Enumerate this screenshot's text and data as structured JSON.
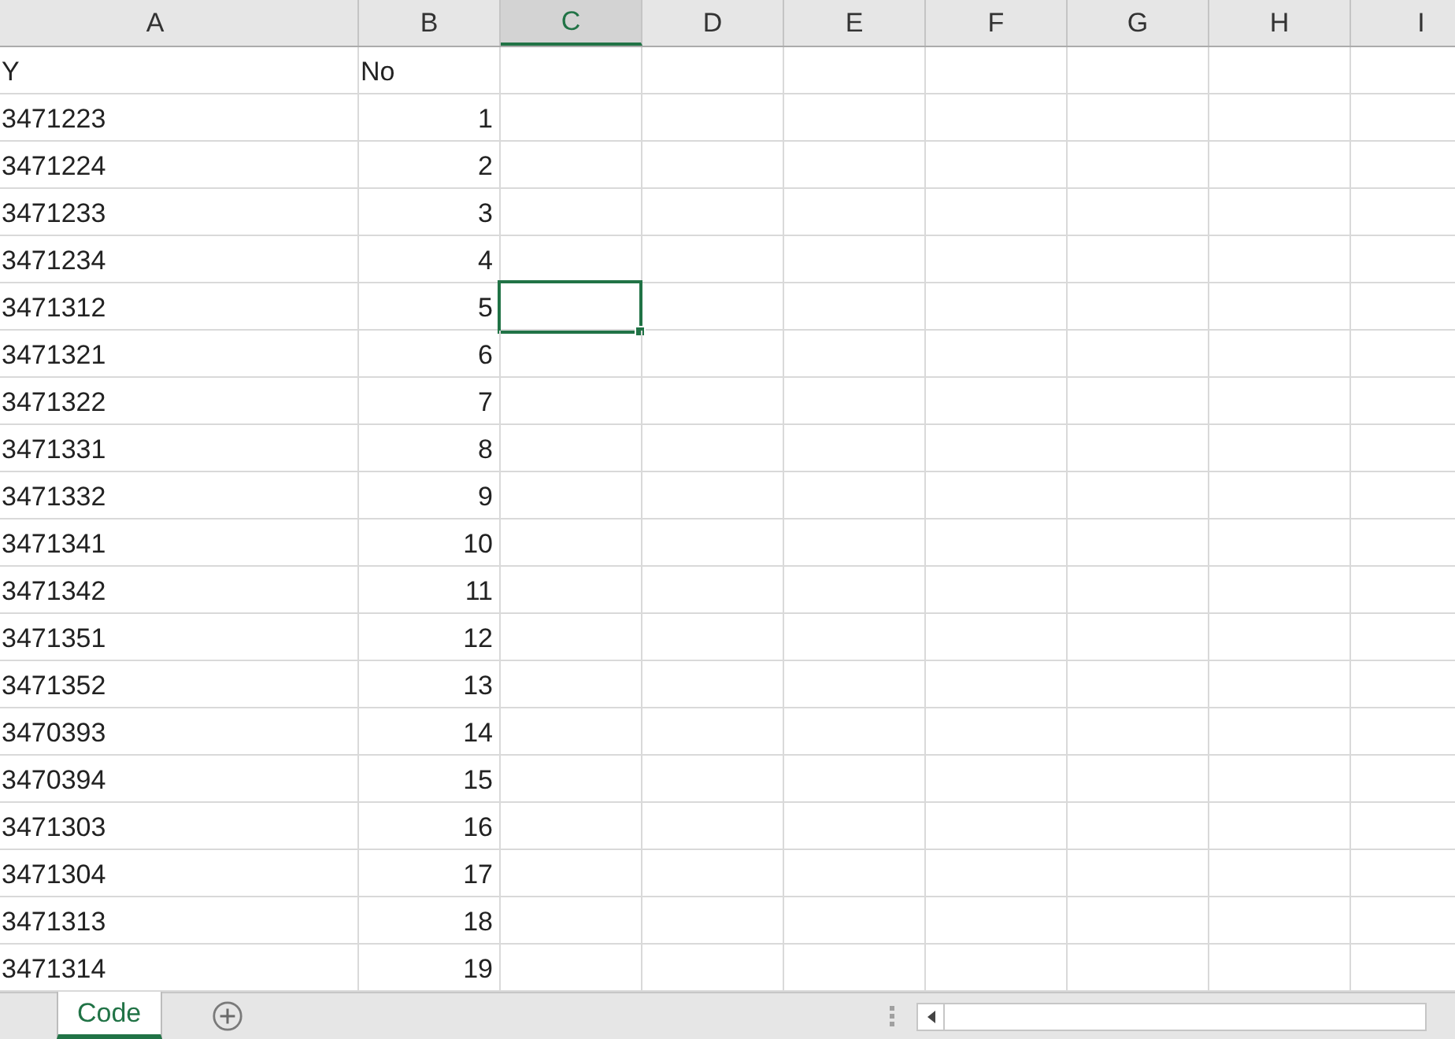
{
  "columns": [
    {
      "label": "A",
      "selected": false
    },
    {
      "label": "B",
      "selected": false
    },
    {
      "label": "C",
      "selected": true
    },
    {
      "label": "D",
      "selected": false
    },
    {
      "label": "E",
      "selected": false
    },
    {
      "label": "F",
      "selected": false
    },
    {
      "label": "G",
      "selected": false
    },
    {
      "label": "H",
      "selected": false
    },
    {
      "label": "I",
      "selected": false
    }
  ],
  "rows": [
    {
      "selected": false,
      "cells": [
        {
          "text": "Y",
          "kind": "text"
        },
        {
          "text": "No",
          "kind": "text"
        }
      ]
    },
    {
      "selected": false,
      "cells": [
        {
          "text": "3471223",
          "kind": "text"
        },
        {
          "text": "1",
          "kind": "number"
        }
      ]
    },
    {
      "selected": false,
      "cells": [
        {
          "text": "3471224",
          "kind": "text"
        },
        {
          "text": "2",
          "kind": "number"
        }
      ]
    },
    {
      "selected": false,
      "cells": [
        {
          "text": "3471233",
          "kind": "text"
        },
        {
          "text": "3",
          "kind": "number"
        }
      ]
    },
    {
      "selected": false,
      "cells": [
        {
          "text": "3471234",
          "kind": "text"
        },
        {
          "text": "4",
          "kind": "number"
        }
      ]
    },
    {
      "selected": true,
      "cells": [
        {
          "text": "3471312",
          "kind": "text"
        },
        {
          "text": "5",
          "kind": "number"
        }
      ]
    },
    {
      "selected": false,
      "cells": [
        {
          "text": "3471321",
          "kind": "text"
        },
        {
          "text": "6",
          "kind": "number"
        }
      ]
    },
    {
      "selected": false,
      "cells": [
        {
          "text": "3471322",
          "kind": "text"
        },
        {
          "text": "7",
          "kind": "number"
        }
      ]
    },
    {
      "selected": false,
      "cells": [
        {
          "text": "3471331",
          "kind": "text"
        },
        {
          "text": "8",
          "kind": "number"
        }
      ]
    },
    {
      "selected": false,
      "cells": [
        {
          "text": "3471332",
          "kind": "text"
        },
        {
          "text": "9",
          "kind": "number"
        }
      ]
    },
    {
      "selected": false,
      "cells": [
        {
          "text": "3471341",
          "kind": "text"
        },
        {
          "text": "10",
          "kind": "number"
        }
      ]
    },
    {
      "selected": false,
      "cells": [
        {
          "text": "3471342",
          "kind": "text"
        },
        {
          "text": "11",
          "kind": "number"
        }
      ]
    },
    {
      "selected": false,
      "cells": [
        {
          "text": "3471351",
          "kind": "text"
        },
        {
          "text": "12",
          "kind": "number"
        }
      ]
    },
    {
      "selected": false,
      "cells": [
        {
          "text": "3471352",
          "kind": "text"
        },
        {
          "text": "13",
          "kind": "number"
        }
      ]
    },
    {
      "selected": false,
      "cells": [
        {
          "text": "3470393",
          "kind": "text"
        },
        {
          "text": "14",
          "kind": "number"
        }
      ]
    },
    {
      "selected": false,
      "cells": [
        {
          "text": "3470394",
          "kind": "text"
        },
        {
          "text": "15",
          "kind": "number"
        }
      ]
    },
    {
      "selected": false,
      "cells": [
        {
          "text": "3471303",
          "kind": "text"
        },
        {
          "text": "16",
          "kind": "number"
        }
      ]
    },
    {
      "selected": false,
      "cells": [
        {
          "text": "3471304",
          "kind": "text"
        },
        {
          "text": "17",
          "kind": "number"
        }
      ]
    },
    {
      "selected": false,
      "cells": [
        {
          "text": "3471313",
          "kind": "text"
        },
        {
          "text": "18",
          "kind": "number"
        }
      ]
    },
    {
      "selected": false,
      "cells": [
        {
          "text": "3471314",
          "kind": "text"
        },
        {
          "text": "19",
          "kind": "number"
        }
      ]
    }
  ],
  "sheet_tabs": [
    {
      "label": "Code",
      "selected": true
    }
  ]
}
